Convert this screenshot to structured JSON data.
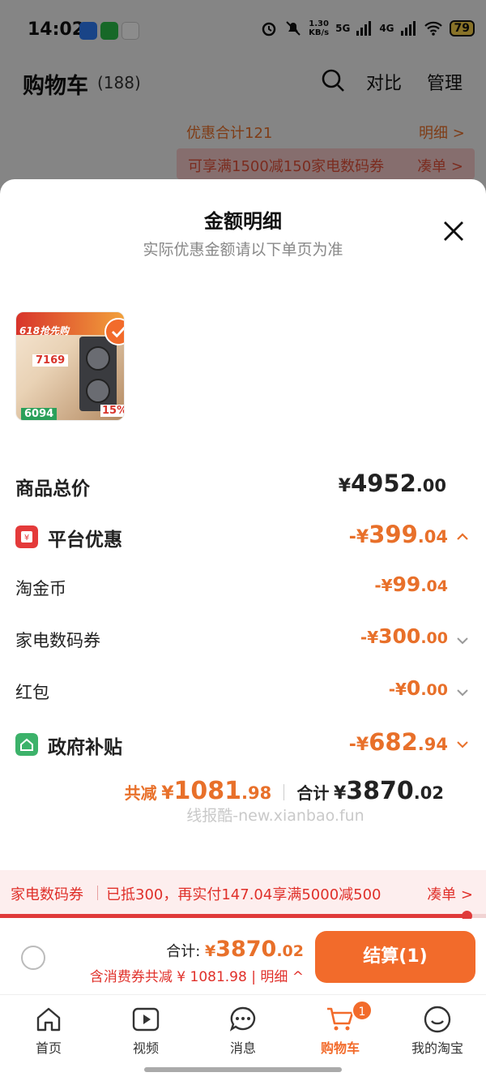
{
  "status_bar": {
    "time": "14:02",
    "net_speed_value": "1.30",
    "net_speed_unit": "KB/s",
    "signal1": "5G",
    "signal2": "4G",
    "battery": "79"
  },
  "cart_header": {
    "title": "购物车",
    "count": "(188)",
    "compare_label": "对比",
    "manage_label": "管理"
  },
  "background_rows": {
    "discount_total": "优惠合计121",
    "detail_link": "明细 >",
    "coupon_text": "可享满1500减150家电数码券",
    "coupon_action": "凑单 >"
  },
  "sheet": {
    "title": "金额明细",
    "subtitle": "实际优惠金额请以下单页为准",
    "thumbnail": {
      "badge": "618抢先购",
      "price_top": "7169",
      "price_bottom": "6094",
      "percent": "15%"
    },
    "rows": [
      {
        "label": "商品总价",
        "sym": "¥",
        "int": "4952",
        "dec": ".00"
      },
      {
        "label": "平台优惠",
        "sym": "-¥",
        "int": "399",
        "dec": ".04"
      },
      {
        "label": "淘金币",
        "sym": "-¥",
        "int": "99",
        "dec": ".04"
      },
      {
        "label": "家电数码券",
        "sym": "-¥",
        "int": "300",
        "dec": ".00"
      },
      {
        "label": "红包",
        "sym": "-¥",
        "int": "0",
        "dec": ".00"
      },
      {
        "label": "政府补贴",
        "sym": "-¥",
        "int": "682",
        "dec": ".94"
      }
    ],
    "total": {
      "reduce_label": "共减",
      "reduce_sym": "¥",
      "reduce_int": "1081",
      "reduce_dec": ".98",
      "sum_label": "合计",
      "sum_sym": "¥",
      "sum_int": "3870",
      "sum_dec": ".02"
    },
    "watermark": "线报酷-new.xianbao.fun"
  },
  "coupon_bar": {
    "label": "家电数码券",
    "message": "已抵300，再实付147.04享满5000减500",
    "action": "凑单 >",
    "progress": 0.96
  },
  "checkout": {
    "sum_label": "合计:",
    "sum_sym": "¥",
    "sum_int": "3870",
    "sum_dec": ".02",
    "sub_text": "含消费券共减 ¥ 1081.98 | 明细 ^",
    "pay_label": "结算(1)"
  },
  "tabbar": {
    "tabs": [
      {
        "label": "首页",
        "icon": "home-icon"
      },
      {
        "label": "视频",
        "icon": "video-icon"
      },
      {
        "label": "消息",
        "icon": "message-icon"
      },
      {
        "label": "购物车",
        "icon": "cart-icon",
        "badge": "1"
      },
      {
        "label": "我的淘宝",
        "icon": "profile-icon"
      }
    ]
  },
  "colors": {
    "accent": "#f26b2b",
    "discount": "#e8702a",
    "coupon_red": "#e0302a"
  }
}
